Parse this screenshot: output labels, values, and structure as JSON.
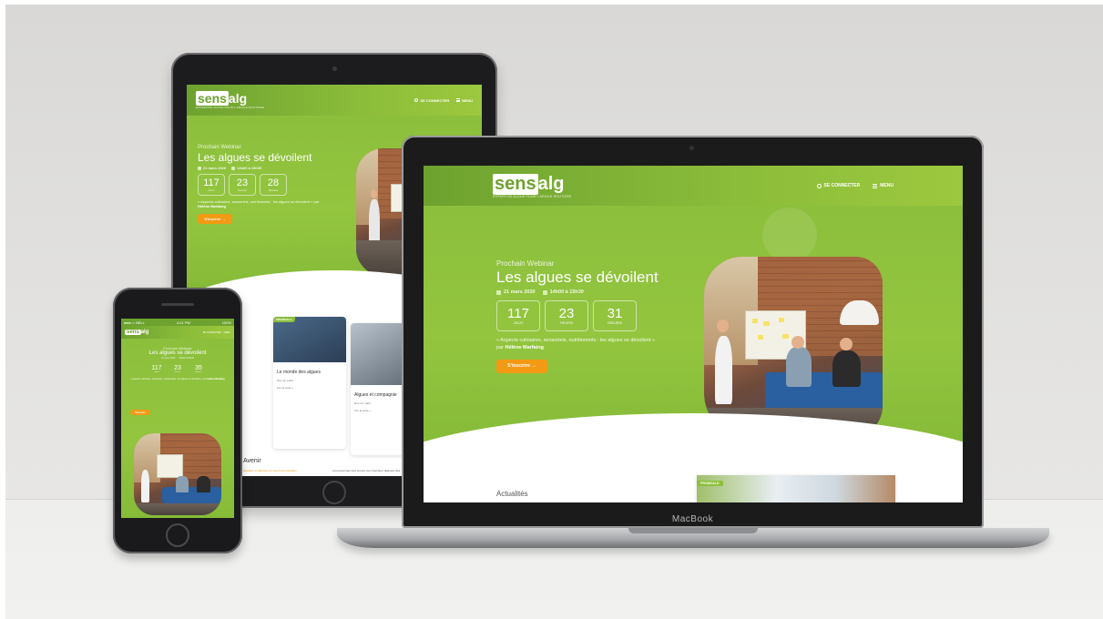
{
  "site": {
    "logo_box": "sens",
    "logo_rest": "alg",
    "logo_tagline": "EXPERTISE ALGUE POUR L'ARGILE ROUTIERE",
    "nav": {
      "login": "SE CONNECTER",
      "menu": "MENU"
    }
  },
  "hero": {
    "kicker": "Prochain Webinar",
    "title": "Les algues se dévoilent",
    "date": "21 mars 2020",
    "time": "14h00 à 15h30",
    "countdown": [
      {
        "value": "117",
        "label": "Jours"
      },
      {
        "value": "23",
        "label": "Heures"
      },
      {
        "value": "31",
        "label": "Minutes"
      }
    ],
    "countdown_tablet": [
      {
        "value": "117",
        "label": "Jours"
      },
      {
        "value": "23",
        "label": "Heures"
      },
      {
        "value": "28",
        "label": "Minutes"
      }
    ],
    "countdown_phone": [
      {
        "value": "117",
        "label": "Jours"
      },
      {
        "value": "23",
        "label": "Heures"
      },
      {
        "value": "35",
        "label": "Minutes"
      }
    ],
    "description": "« Aspects culinaires, sensoriels, nutritionnels : les algues se dévoilent »",
    "speaker_prefix": "par",
    "speaker": "Hélène Marfaing",
    "cta": "S'inscrire"
  },
  "laptop": {
    "section_title": "Actualités",
    "badge": "PROMOALG",
    "brand": "MacBook"
  },
  "tablet": {
    "card1_title": "Le monde des algues",
    "card1_text": "Des ver partir",
    "card1_link": "Lire la suite »",
    "card2_title": "Algues et compagnie",
    "card2_text": "Des ver partir",
    "card2_link": "Lire la suite »",
    "badge": "PROMOALG",
    "section_title": "Avenir",
    "orange_text": "Naviguer et déployer en vue d'une transition",
    "body_text": "Les personnes sont encore vos chercheur déjà aux clés"
  },
  "phone": {
    "carrier": "●●●○○ BELL",
    "time": "4:21 PM",
    "battery": "100%"
  },
  "colors": {
    "brand_green": "#8cbf3c",
    "dark_green": "#6da22f",
    "cta_orange": "#f39a14"
  }
}
